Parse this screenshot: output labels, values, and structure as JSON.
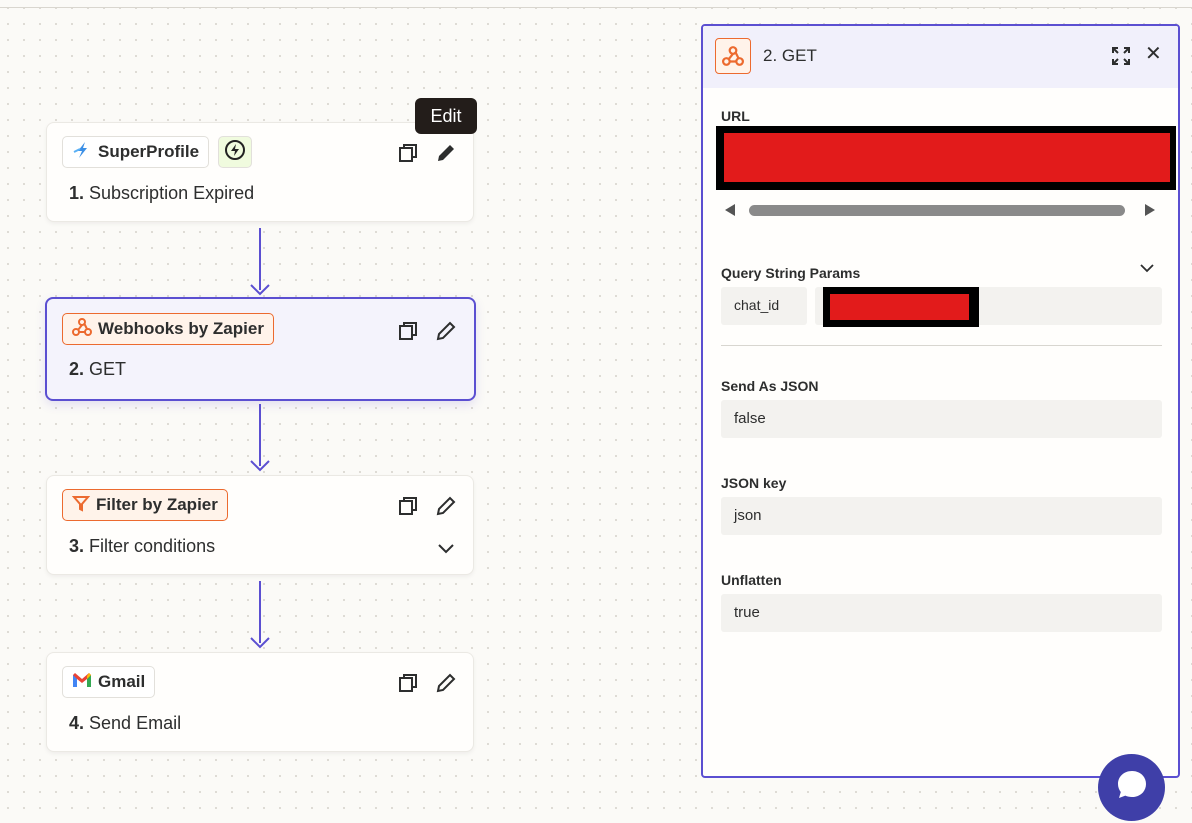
{
  "tooltip": {
    "text": "Edit"
  },
  "steps": [
    {
      "app": "SuperProfile",
      "number": "1.",
      "title": "Subscription Expired",
      "trigger_icon": "bolt-icon"
    },
    {
      "app": "Webhooks by Zapier",
      "number": "2.",
      "title": "GET"
    },
    {
      "app": "Filter by Zapier",
      "number": "3.",
      "title": "Filter conditions"
    },
    {
      "app": "Gmail",
      "number": "4.",
      "title": "Send Email"
    }
  ],
  "panel": {
    "title": "2. GET",
    "url_label": "URL",
    "query_label": "Query String Params",
    "param_key": "chat_id",
    "send_json_label": "Send As JSON",
    "send_json_value": "false",
    "json_key_label": "JSON key",
    "json_key_value": "json",
    "unflatten_label": "Unflatten",
    "unflatten_value": "true"
  },
  "colors": {
    "accent": "#5b4fd1",
    "zapier_orange": "#ec6a2f",
    "redaction": "#e21b1b",
    "chat_button": "#3f3fa8"
  }
}
